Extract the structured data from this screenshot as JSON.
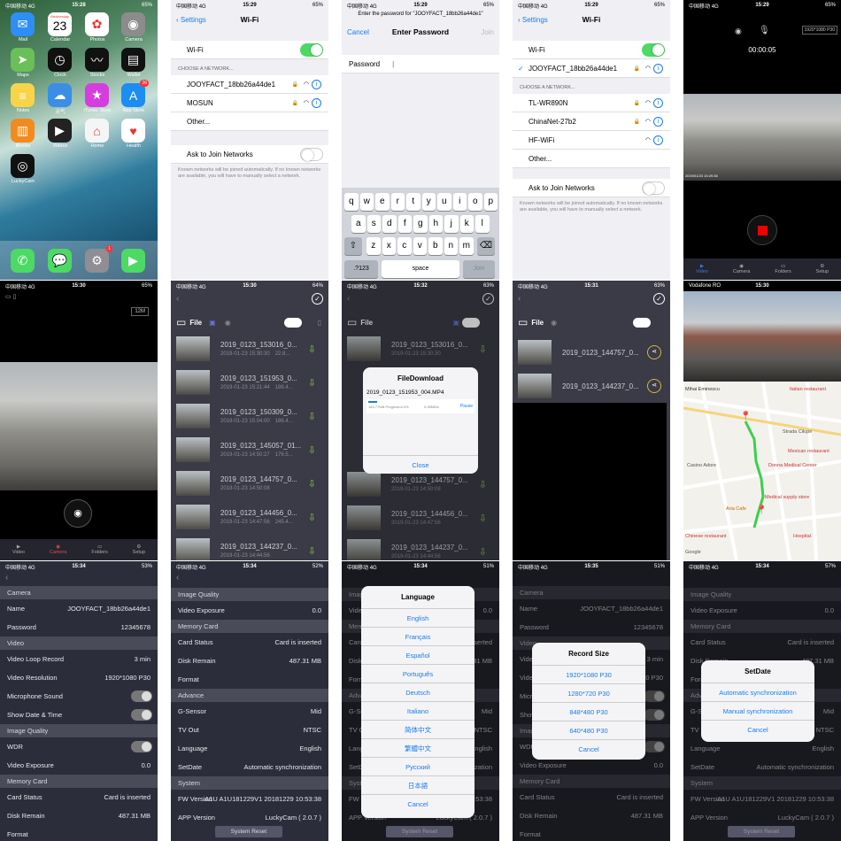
{
  "status": {
    "home": {
      "carrier": "中国移动",
      "net": "4G",
      "time": "15:28",
      "bat": "65%"
    },
    "wifi1": {
      "carrier": "中国移动",
      "net": "4G",
      "time": "15:29",
      "bat": "65%"
    },
    "pw": {
      "carrier": "中国移动",
      "net": "4G",
      "time": "15:29",
      "bat": "65%"
    },
    "wifi2": {
      "carrier": "中国移动",
      "net": "4G",
      "time": "15:29",
      "bat": "65%"
    },
    "cam1": {
      "carrier": "中国移动",
      "net": "4G",
      "time": "15:29",
      "bat": "65%"
    },
    "cam2": {
      "carrier": "中国移动",
      "net": "4G",
      "time": "15:30",
      "bat": "65%"
    },
    "file1": {
      "carrier": "中国移动",
      "net": "4G",
      "time": "15:30",
      "bat": "64%"
    },
    "file2": {
      "carrier": "中国移动",
      "net": "4G",
      "time": "15:32",
      "bat": "63%"
    },
    "file3": {
      "carrier": "中国移动",
      "net": "4G",
      "time": "15:31",
      "bat": "63%"
    },
    "map": {
      "carrier": "Vodafone RO",
      "net": "",
      "time": "15:30",
      "bat": ""
    },
    "set1": {
      "carrier": "中国移动",
      "net": "4G",
      "time": "15:34",
      "bat": "53%"
    },
    "set2": {
      "carrier": "中国移动",
      "net": "4G",
      "time": "15:34",
      "bat": "52%"
    },
    "set3": {
      "carrier": "中国移动",
      "net": "4G",
      "time": "15:34",
      "bat": "51%"
    },
    "set4": {
      "carrier": "中国移动",
      "net": "4G",
      "time": "15:35",
      "bat": "51%"
    },
    "set5": {
      "carrier": "中国移动",
      "net": "4G",
      "time": "15:34",
      "bat": "57%"
    }
  },
  "home": {
    "date_day": "Wednesday",
    "date_num": "23",
    "apps": [
      {
        "label": "Mail",
        "icon": "mail-icon",
        "color": "#2d8ef5",
        "glyph": "✉"
      },
      {
        "label": "Calendar",
        "icon": "calendar-icon",
        "color": "#ffffff",
        "glyph": ""
      },
      {
        "label": "Photos",
        "icon": "photos-icon",
        "color": "#ffffff",
        "glyph": "✿"
      },
      {
        "label": "Camera",
        "icon": "camera-icon",
        "color": "#8c8c8c",
        "glyph": "◉"
      },
      {
        "label": "Maps",
        "icon": "maps-icon",
        "color": "#6bbf59",
        "glyph": "➤"
      },
      {
        "label": "Clock",
        "icon": "clock-icon",
        "color": "#111111",
        "glyph": "◷"
      },
      {
        "label": "Stocks",
        "icon": "stocks-icon",
        "color": "#111111",
        "glyph": "〰"
      },
      {
        "label": "Wallet",
        "icon": "wallet-icon",
        "color": "#111111",
        "glyph": "▤"
      },
      {
        "label": "Notes",
        "icon": "notes-icon",
        "color": "#f9d449",
        "glyph": "≡"
      },
      {
        "label": "天气",
        "icon": "weather-icon",
        "color": "#3a8ee6",
        "glyph": "☁"
      },
      {
        "label": "iTunes Store",
        "icon": "itunes-icon",
        "color": "#d63ddf",
        "glyph": "★"
      },
      {
        "label": "App Store",
        "icon": "appstore-icon",
        "color": "#1c8df2",
        "glyph": "A",
        "badge": "26"
      },
      {
        "label": "iBooks",
        "icon": "ibooks-icon",
        "color": "#f28a1d",
        "glyph": "▥"
      },
      {
        "label": "Videos",
        "icon": "videos-icon",
        "color": "#222222",
        "glyph": "▶"
      },
      {
        "label": "Home",
        "icon": "home-icon",
        "color": "#f5f5f5",
        "glyph": "⌂"
      },
      {
        "label": "Health",
        "icon": "health-icon",
        "color": "#ffffff",
        "glyph": "♥"
      },
      {
        "label": "LuckyCam",
        "icon": "luckycam-icon",
        "color": "#111111",
        "glyph": "◎"
      }
    ],
    "dock": [
      {
        "icon": "phone-icon",
        "color": "#4cd964",
        "glyph": "✆"
      },
      {
        "icon": "messages-icon",
        "color": "#4cd964",
        "glyph": "💬"
      },
      {
        "icon": "settings-icon",
        "color": "#8e8e93",
        "glyph": "⚙",
        "badge": "1"
      },
      {
        "icon": "facetime-icon",
        "color": "#4cd964",
        "glyph": "▶"
      }
    ]
  },
  "wifi1": {
    "back": "Settings",
    "title": "Wi-Fi",
    "wifi_label": "Wi-Fi",
    "choose": "CHOOSE A NETWORK...",
    "networks": [
      "JOOYFACT_18bb26a44de1",
      "MOSUN"
    ],
    "other": "Other...",
    "ask": "Ask to Join Networks",
    "foot": "Known networks will be joined automatically. If no known networks are available, you will have to manually select a network."
  },
  "pw": {
    "prompt": "Enter the password for \"JOOYFACT_18bb26a44de1\"",
    "cancel": "Cancel",
    "title": "Enter Password",
    "join": "Join",
    "field": "Password",
    "row1": [
      "q",
      "w",
      "e",
      "r",
      "t",
      "y",
      "u",
      "i",
      "o",
      "p"
    ],
    "row2": [
      "a",
      "s",
      "d",
      "f",
      "g",
      "h",
      "j",
      "k",
      "l"
    ],
    "row3": [
      "z",
      "x",
      "c",
      "v",
      "b",
      "n",
      "m"
    ],
    "num": ".?123",
    "space": "space",
    "join_key": "Join"
  },
  "wifi2": {
    "back": "Settings",
    "title": "Wi-Fi",
    "wifi_label": "Wi-Fi",
    "connected": "JOOYFACT_18bb26a44de1",
    "choose": "CHOOSE A NETWORK...",
    "networks": [
      "TL-WR890N",
      "ChinaNet-27b2",
      "HF-WiFi"
    ],
    "other": "Other...",
    "ask": "Ask to Join Networks",
    "foot": "Known networks will be joined automatically. If no known networks are available, you will have to manually select a network."
  },
  "cam1": {
    "timer": "00:00:05",
    "res": "1920*1080 P30",
    "ts": "2019/01/23 15:29:35",
    "tabs": [
      "Video",
      "Camera",
      "Folders",
      "Setup"
    ]
  },
  "cam2": {
    "res": "12M",
    "tabs": [
      "Video",
      "Camera",
      "Folders",
      "Setup"
    ]
  },
  "files1": {
    "title": "File",
    "items": [
      {
        "name": "2019_0123_153016_0...",
        "date": "2019-01-23 15:30:30",
        "size": "22.8..."
      },
      {
        "name": "2019_0123_151953_0...",
        "date": "2019-01-23 15:21:44",
        "size": "186.4..."
      },
      {
        "name": "2019_0123_150309_0...",
        "date": "2019-01-23 15:04:00",
        "size": "186.4..."
      },
      {
        "name": "2019_0123_145057_01...",
        "date": "2019-01-23 14:50:27",
        "size": "176.5..."
      },
      {
        "name": "2019_0123_144757_0...",
        "date": "2019-01-23 14:50:08",
        "size": ""
      },
      {
        "name": "2019_0123_144456_0...",
        "date": "2019-01-23 14:47:56",
        "size": "245.4..."
      },
      {
        "name": "2019_0123_144237_0...",
        "date": "2019-01-23 14:44:56",
        "size": ""
      }
    ]
  },
  "files2": {
    "title": "File",
    "dialog_title": "FileDownload",
    "dialog_file": "2019_0123_151953_004.MP4",
    "dialog_status": "164.77MB  Progress:8.0%",
    "dialog_speed": "0.35MB/s",
    "pause": "Pause",
    "close": "Close",
    "items": [
      {
        "name": "2019_0123_153016_0...",
        "date": "2019-01-23 15:30:30"
      },
      {
        "name": "2019_0123_144757_0...",
        "date": "2019-01-23 14:50:08"
      },
      {
        "name": "2019_0123_144456_0...",
        "date": "2019-01-23 14:47:56"
      },
      {
        "name": "2019_0123_144237_0...",
        "date": "2019-01-23 14:44:56"
      }
    ]
  },
  "files3": {
    "title": "File",
    "items": [
      {
        "name": "2019_0123_144757_0..."
      },
      {
        "name": "2019_0123_144237_0..."
      }
    ]
  },
  "map": {
    "labels": [
      {
        "t": "Mihai Eminescu"
      },
      {
        "t": "Italian restaurant"
      },
      {
        "t": "Strada Cilupe"
      },
      {
        "t": "Mexican restaurant"
      },
      {
        "t": "Casino Adore"
      },
      {
        "t": "Donna Medical Center"
      },
      {
        "t": "Medical supply store"
      },
      {
        "t": "Aria Cafe"
      },
      {
        "t": "Chinese restaurant"
      },
      {
        "t": "Hospital"
      },
      {
        "t": "Google"
      }
    ]
  },
  "set1": {
    "rows": [
      {
        "h": "Camera"
      },
      {
        "k": "Name",
        "v": "JOOYFACT_18bb26a44de1"
      },
      {
        "k": "Password",
        "v": "12345678"
      },
      {
        "h": "Video"
      },
      {
        "k": "Video Loop Record",
        "v": "3 min"
      },
      {
        "k": "Video Resolution",
        "v": "1920*1080 P30"
      },
      {
        "k": "Microphone Sound",
        "t": true
      },
      {
        "k": "Show Date & Time",
        "t": true
      },
      {
        "h": "Image Quality"
      },
      {
        "k": "WDR",
        "t": true
      },
      {
        "k": "Video Exposure",
        "v": "0.0"
      },
      {
        "h": "Memory Card"
      },
      {
        "k": "Card Status",
        "v": "Card is inserted"
      },
      {
        "k": "Disk Remain",
        "v": "487.31 MB"
      },
      {
        "k": "Format",
        "v": ""
      }
    ]
  },
  "set2": {
    "rows": [
      {
        "h": "Image Quality"
      },
      {
        "k": "Video Exposure",
        "v": "0.0"
      },
      {
        "h": "Memory Card"
      },
      {
        "k": "Card Status",
        "v": "Card is inserted"
      },
      {
        "k": "Disk Remain",
        "v": "487.31 MB"
      },
      {
        "k": "Format",
        "v": ""
      },
      {
        "h": "Advance"
      },
      {
        "k": "G-Sensor",
        "v": "Mid"
      },
      {
        "k": "TV Out",
        "v": "NTSC"
      },
      {
        "k": "Language",
        "v": "English"
      },
      {
        "k": "SetDate",
        "v": "Automatic synchronization"
      },
      {
        "h": "System"
      },
      {
        "k": "FW Version",
        "v": "A1U  A1U181229V1  20181229 10:53:38"
      },
      {
        "k": "APP Version",
        "v": "LuckyCam ( 2.0.7 )"
      }
    ],
    "reset": "System Reset"
  },
  "set3": {
    "title": "Language",
    "options": [
      "English",
      "Français",
      "Español",
      "Português",
      "Deutsch",
      "Italiano",
      "简体中文",
      "繁體中文",
      "Русский",
      "日本語"
    ],
    "cancel": "Cancel",
    "reset": "System Reset"
  },
  "set4": {
    "rows": [
      {
        "h": "Camera"
      },
      {
        "k": "Name",
        "v": "JOOYFACT_18bb26a44de1"
      },
      {
        "k": "Password",
        "v": "12345678"
      },
      {
        "h": "Video"
      },
      {
        "k": "Video Loop Record",
        "v": "3 min"
      },
      {
        "k": "Video Resolution",
        "v": "1920*1080 P30"
      },
      {
        "k": "Microphone Sound",
        "t": true
      },
      {
        "k": "Show Date & Time",
        "t": true
      },
      {
        "h": "Image Quality"
      },
      {
        "k": "WDR",
        "t": true
      },
      {
        "k": "Video Exposure",
        "v": "0.0"
      },
      {
        "h": "Memory Card"
      },
      {
        "k": "Card Status",
        "v": "Card is inserted"
      },
      {
        "k": "Disk Remain",
        "v": "487.31 MB"
      },
      {
        "k": "Format",
        "v": ""
      }
    ],
    "title": "Record Size",
    "options": [
      "1920*1080 P30",
      "1280*720 P30",
      "848*480 P30",
      "640*480 P30"
    ],
    "cancel": "Cancel"
  },
  "set5": {
    "rows": [
      {
        "h": "Image Quality"
      },
      {
        "k": "Video Exposure",
        "v": "0.0"
      },
      {
        "h": "Memory Card"
      },
      {
        "k": "Card Status",
        "v": "Card is inserted"
      },
      {
        "k": "Disk Remain",
        "v": "487.31 MB"
      },
      {
        "k": "Format",
        "v": ""
      },
      {
        "h": "Advance"
      },
      {
        "k": "G-Sensor",
        "v": "Mid"
      },
      {
        "k": "TV Out",
        "v": "NTSC"
      },
      {
        "k": "Language",
        "v": "English"
      },
      {
        "k": "SetDate",
        "v": "Automatic synchronization"
      },
      {
        "h": "System"
      },
      {
        "k": "FW Version",
        "v": "A1U  A1U181229V1  20181229 10:53:38"
      },
      {
        "k": "APP Version",
        "v": "LuckyCam ( 2.0.7 )"
      }
    ],
    "title": "SetDate",
    "options": [
      "Automatic synchronization",
      "Manual synchronization"
    ],
    "cancel": "Cancel",
    "reset": "System Reset"
  }
}
